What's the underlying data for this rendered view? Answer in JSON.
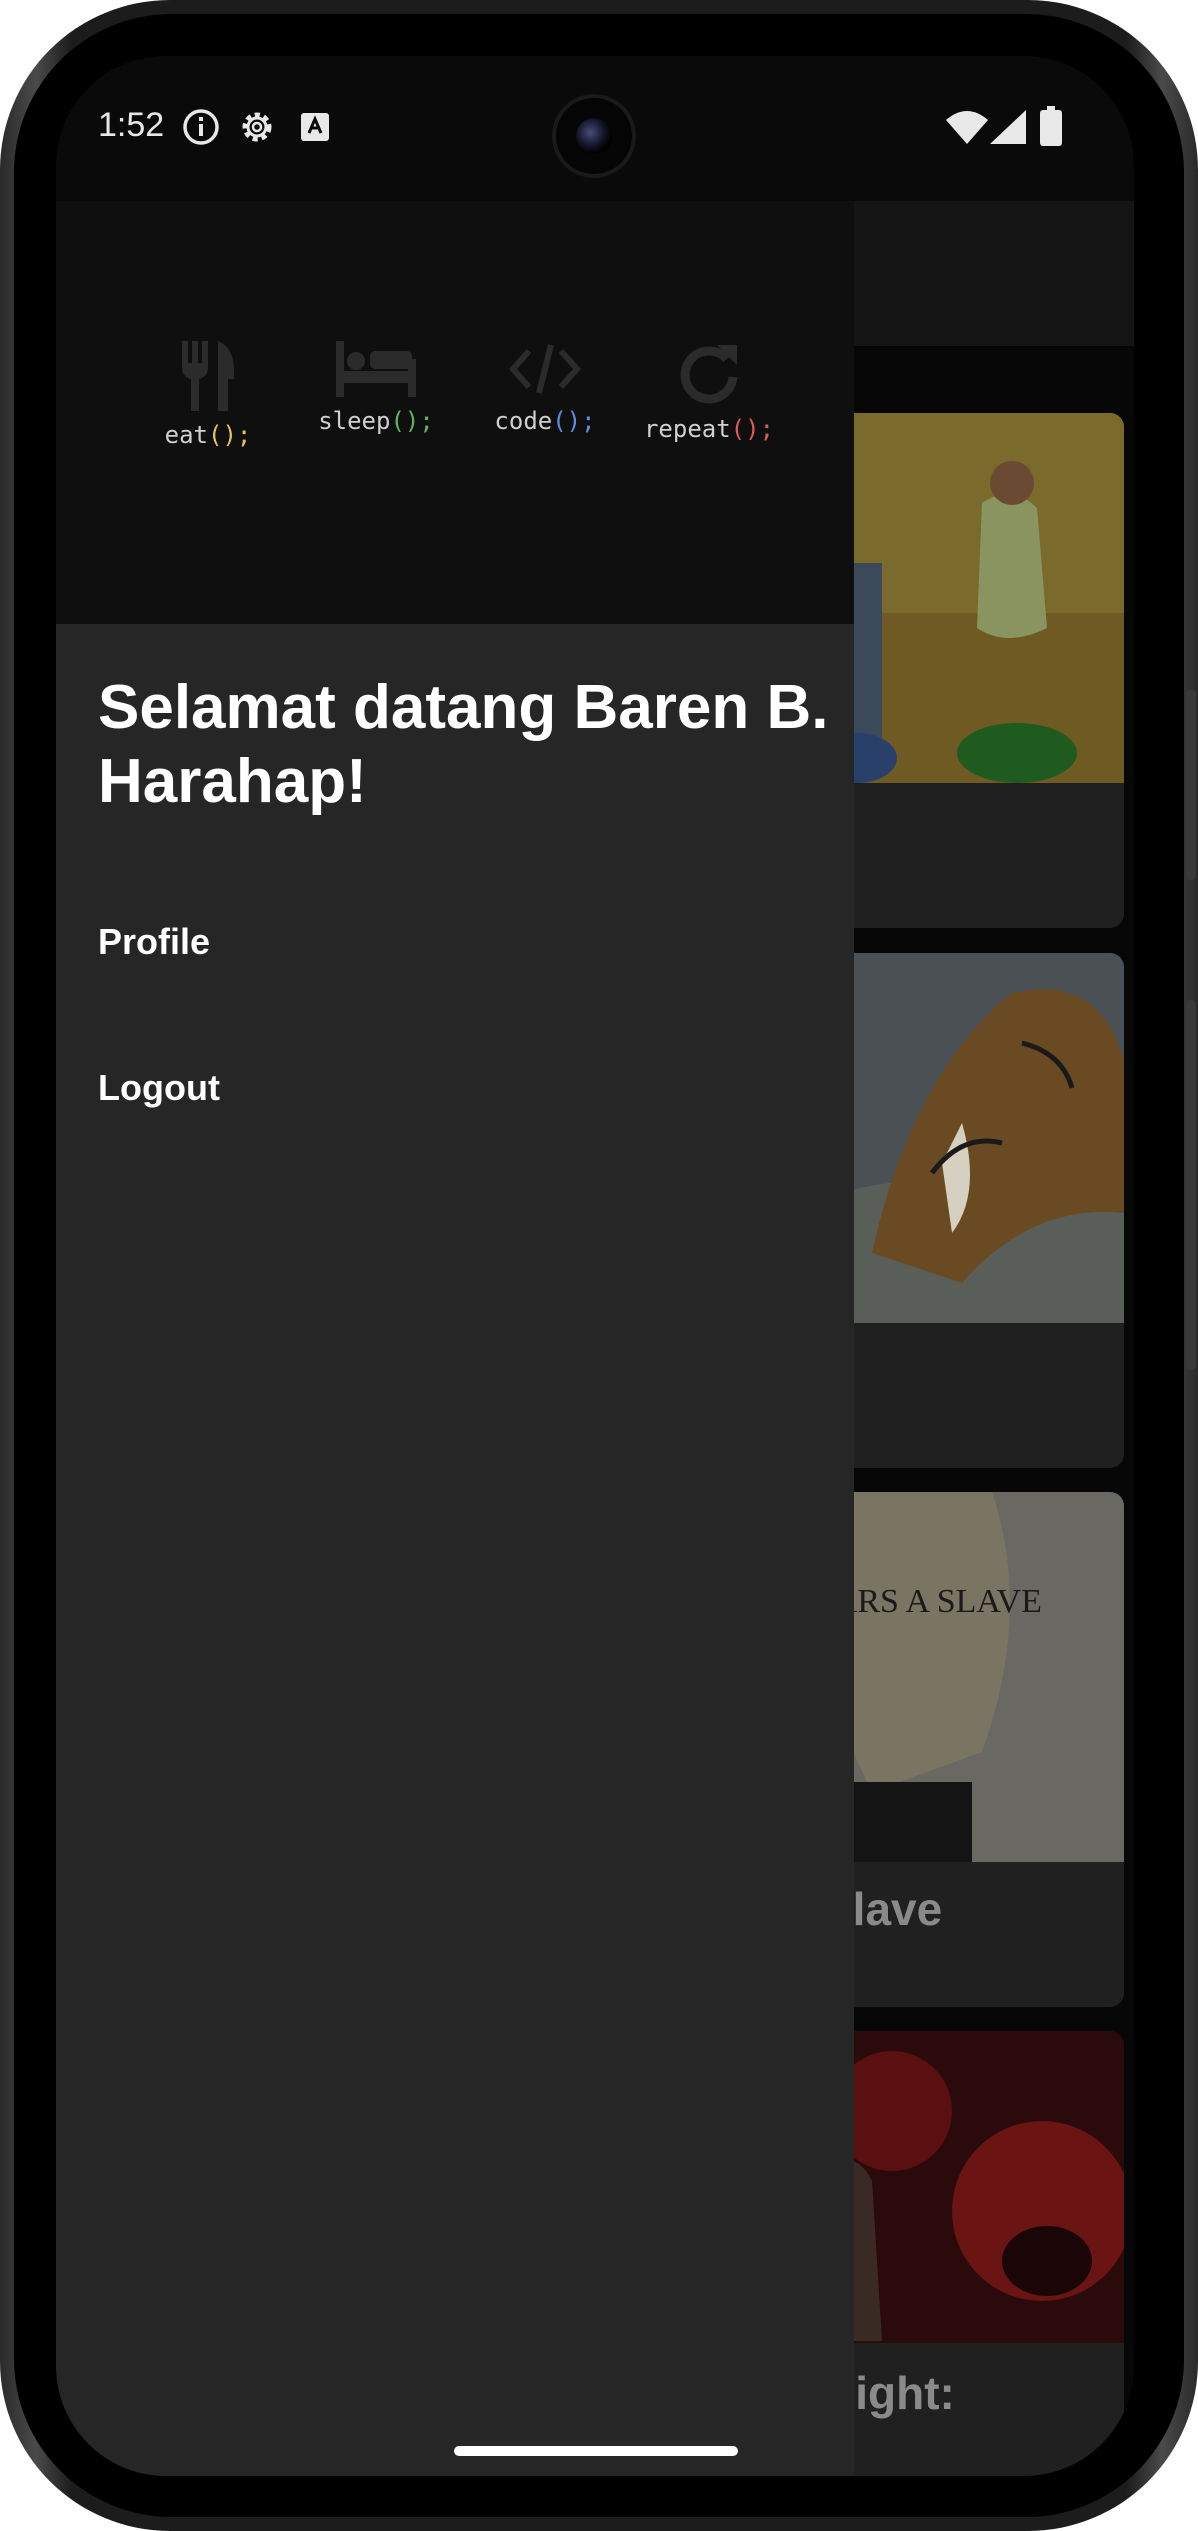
{
  "status_bar": {
    "time": "1:52",
    "left_icons": [
      "info-icon",
      "settings-icon",
      "keyboard-a-icon"
    ],
    "right_icons": [
      "wifi-icon",
      "signal-icon",
      "battery-icon"
    ]
  },
  "drawer": {
    "hobbies": [
      {
        "icon": "fork-knife-icon",
        "name": "eat",
        "paren": "();",
        "paren_color": "#e8c35a"
      },
      {
        "icon": "bed-icon",
        "name": "sleep",
        "paren": "();",
        "paren_color": "#5fb55a"
      },
      {
        "icon": "code-icon",
        "name": "code",
        "paren": "();",
        "paren_color": "#5a8fe0"
      },
      {
        "icon": "refresh-icon",
        "name": "repeat",
        "paren": "();",
        "paren_color": "#e05a5a"
      }
    ],
    "welcome": "Selamat datang Baren B. Harahap!",
    "menu": {
      "profile": "Profile",
      "logout": "Logout"
    }
  },
  "background_cards": [
    {
      "title": ""
    },
    {
      "title": ""
    },
    {
      "title": "Slave"
    },
    {
      "title": "Night:"
    }
  ],
  "colors": {
    "drawer_bg": "#262626",
    "drawer_header_bg": "#0f0f0f",
    "text": "#ffffff"
  }
}
